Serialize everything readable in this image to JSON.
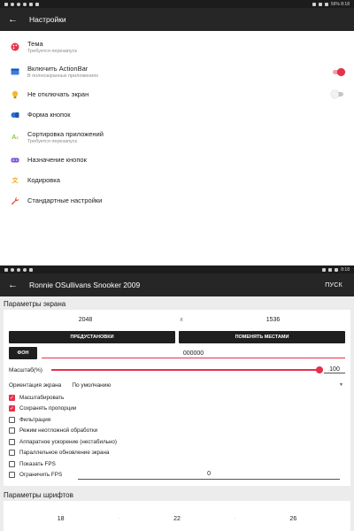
{
  "colors": {
    "accent": "#e8304a",
    "appbar": "#262626",
    "statusbar": "#1c1c1c"
  },
  "status_top": {
    "right": "56% 8:18"
  },
  "status_bottom": {
    "right": "8:18"
  },
  "settings": {
    "title": "Настройки",
    "items": [
      {
        "icon": "palette-icon",
        "label": "Тема",
        "sub": "Требуется перезапуск"
      },
      {
        "icon": "actionbar-icon",
        "label": "Включить ActionBar",
        "sub": "В полноэкранных приложениях",
        "toggle": true
      },
      {
        "icon": "bulb-icon",
        "label": "Не отключать экран",
        "toggle": false
      },
      {
        "icon": "button-shape-icon",
        "label": "Форма кнопок"
      },
      {
        "icon": "sort-az-icon",
        "label": "Сортировка приложений",
        "sub": "Требуется перезапуск"
      },
      {
        "icon": "gamepad-icon",
        "label": "Назначение кнопок"
      },
      {
        "icon": "translate-icon",
        "label": "Кодировка"
      },
      {
        "icon": "wrench-icon",
        "label": "Стандартные настройки"
      }
    ]
  },
  "launch": {
    "title": "Ronnie OSullivans Snooker 2009",
    "action": "ПУСК",
    "screen_section": "Параметры экрана",
    "width": "2048",
    "sep": "x",
    "height": "1536",
    "presets_label": "ПРЕДУСТАНОВКИ",
    "swap_label": "ПОМЕНЯТЬ МЕСТАМИ",
    "bg_label": "ФОН",
    "bg_value": "000000",
    "scale_label": "Масштаб(%)",
    "scale_value": "100",
    "scale_percent": 100,
    "orientation_label": "Ориентация экрана",
    "orientation_value": "По умолчанию",
    "checkboxes": [
      {
        "label": "Масштабировать",
        "checked": true
      },
      {
        "label": "Сохранять пропорции",
        "checked": true
      },
      {
        "label": "Фильтрация",
        "checked": false
      },
      {
        "label": "Режим неотложной обработки",
        "checked": false
      },
      {
        "label": "Аппаратное ускорение (нестабильно)",
        "checked": false
      },
      {
        "label": "Параллельное обновление экрана",
        "checked": false
      },
      {
        "label": "Показать FPS",
        "checked": false
      }
    ],
    "fps_limit_label": "Ограничить FPS",
    "fps_limit_value": "0",
    "fonts_section": "Параметры шрифтов",
    "font_sizes": [
      "18",
      "22",
      "26"
    ],
    "font_sep": "·"
  }
}
